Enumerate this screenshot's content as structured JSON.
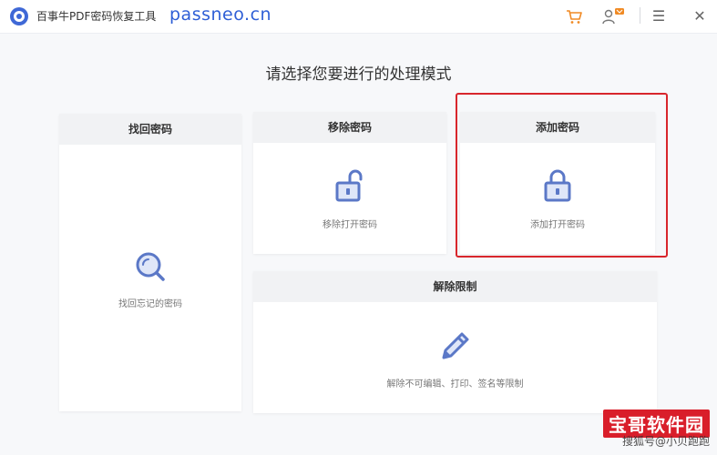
{
  "titlebar": {
    "app_title": "百事牛PDF密码恢复工具",
    "domain": "passneo.cn",
    "icons": [
      "cart-icon",
      "user-vip-icon",
      "menu-icon",
      "close-icon"
    ],
    "menu_glyph": "☰",
    "close_glyph": "✕"
  },
  "main": {
    "prompt": "请选择您要进行的处理模式",
    "cards": [
      {
        "title": "找回密码",
        "desc": "找回忘记的密码",
        "icon": "magnifier-icon"
      },
      {
        "title": "移除密码",
        "desc": "移除打开密码",
        "icon": "unlocked-padlock-icon"
      },
      {
        "title": "添加密码",
        "desc": "添加打开密码",
        "icon": "locked-padlock-icon"
      },
      {
        "title": "解除限制",
        "desc": "解除不可编辑、打印、签名等限制",
        "icon": "pencil-icon"
      }
    ]
  },
  "colors": {
    "accent": "#5b78c7",
    "highlight": "#d8262c",
    "domain_text": "#2f5fd6",
    "cart": "#f08a24"
  },
  "watermark": {
    "logo_text": "宝哥软件园",
    "handle": "搜狐号@小贝跑跑"
  }
}
